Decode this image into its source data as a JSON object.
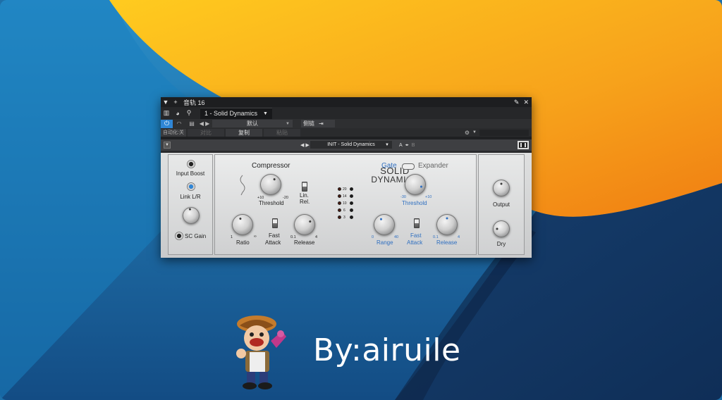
{
  "window": {
    "title": "音轨 16",
    "preset_tab": "1 - Solid Dynamics",
    "default_preset": "默认",
    "sidechain_label": "侧链",
    "automation_label": "自动化:关",
    "compare_label": "对比",
    "copy_label": "复制",
    "paste_label": "粘贴"
  },
  "plugin": {
    "preset_name": "INIT - Solid Dynamics",
    "ab_a": "A",
    "ab_b": "B",
    "title_line1": "SOLID",
    "title_line2": "DYNAMICS",
    "input_boost_label": "Input Boost",
    "link_lr_label": "Link L/R",
    "sc_gain_label": "SC Gain",
    "compressor_label": "Compressor",
    "comp_threshold_label": "Threshold",
    "comp_threshold_min": "+10",
    "comp_threshold_max": "-20",
    "lin_rel_label_1": "Lin.",
    "lin_rel_label_2": "Rel.",
    "ratio_label": "Ratio",
    "ratio_min": "1",
    "ratio_max": "∞",
    "fast_label": "Fast",
    "attack_label": "Attack",
    "release_label": "Release",
    "release_min": "0.1",
    "release_max": "4",
    "meter_scale": [
      "20",
      "14",
      "10",
      "6",
      "3"
    ],
    "gate_label": "Gate",
    "expander_label": "Expander",
    "gate_threshold_label": "Threshold",
    "gate_threshold_min": "-30",
    "gate_threshold_max": "+10",
    "range_label": "Range",
    "range_min": "0",
    "range_max": "40",
    "gate_release_min": "0.1",
    "gate_release_max": "4",
    "output_label": "Output",
    "dry_label": "Dry"
  },
  "branding": {
    "byline": "By:airuile"
  },
  "colors": {
    "accent_blue": "#2f86d6",
    "gate_blue": "#2f6fc0",
    "wallpaper_yellow": "#f6a81c",
    "wallpaper_blue": "#1e6fa8"
  }
}
